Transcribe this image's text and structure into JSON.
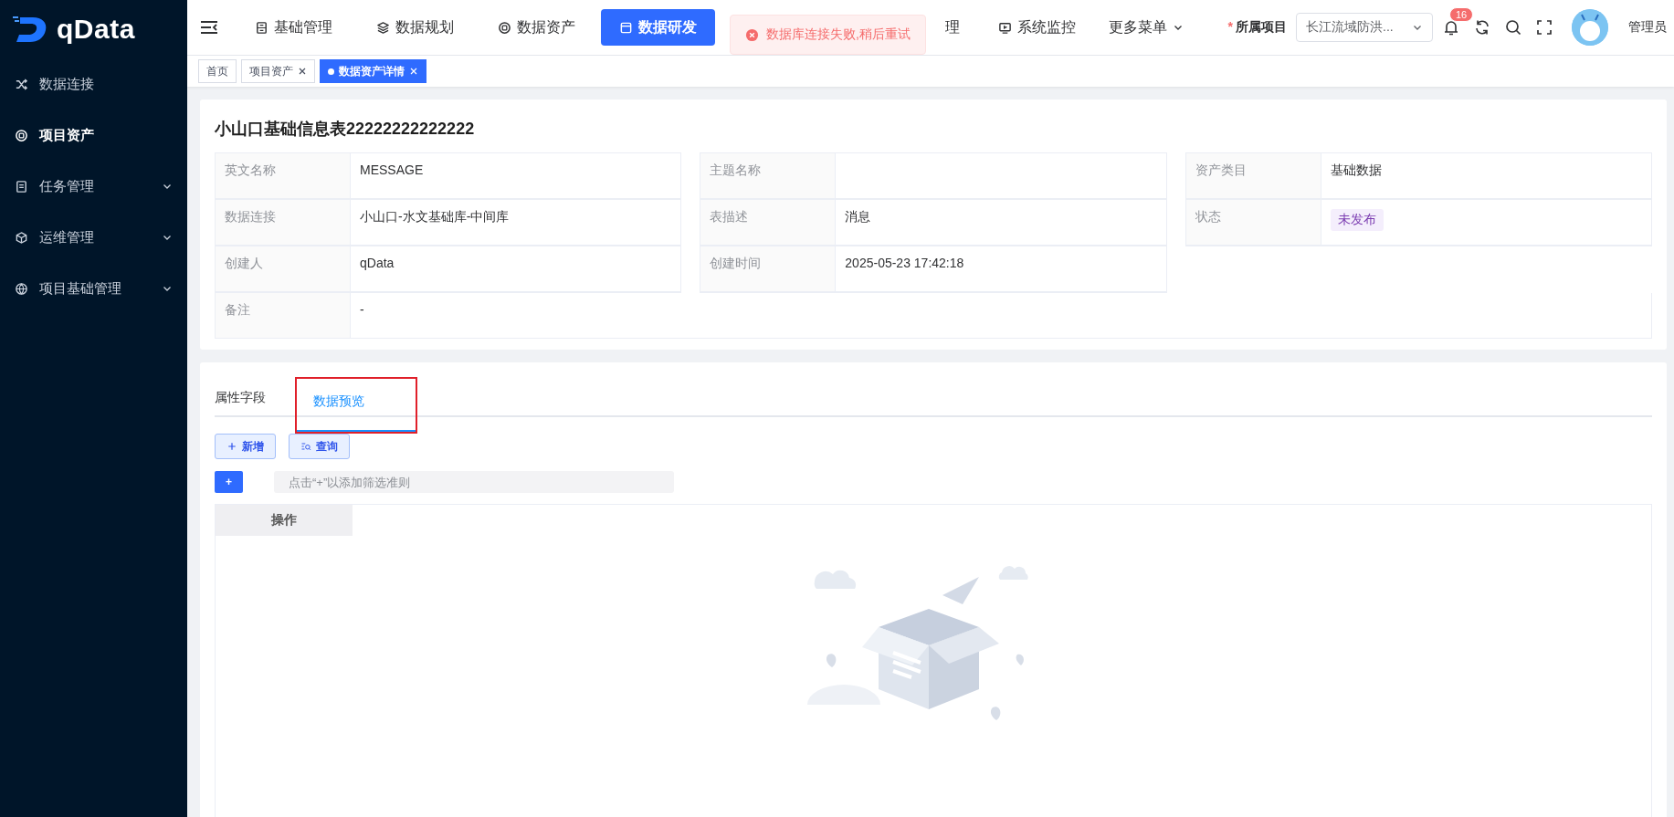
{
  "logo": {
    "text": "qData"
  },
  "sidebar": {
    "items": [
      {
        "label": "数据连接",
        "selected": false
      },
      {
        "label": "项目资产",
        "selected": true
      },
      {
        "label": "任务管理",
        "selected": false,
        "expanded": false
      },
      {
        "label": "运维管理",
        "selected": false,
        "expanded": false
      },
      {
        "label": "项目基础管理",
        "selected": false,
        "expanded": false
      }
    ]
  },
  "top_menu": [
    {
      "label": "基础管理",
      "kind": "link",
      "selected": false
    },
    {
      "label": "数据规划",
      "kind": "link",
      "selected": false
    },
    {
      "label": "数据资产",
      "kind": "link",
      "selected": false
    },
    {
      "label": "数据研发",
      "kind": "link",
      "selected": true
    },
    {
      "label": "理",
      "kind": "link",
      "selected": false
    },
    {
      "label": "系统监控",
      "kind": "link",
      "selected": false
    },
    {
      "label": "更多菜单",
      "kind": "dropdown",
      "selected": false
    }
  ],
  "toast": {
    "message": "数据库连接失败,稍后重试"
  },
  "project": {
    "required_mark": "*",
    "label": "所属项目",
    "value": "长江流域防洪..."
  },
  "notifications": {
    "count": "16"
  },
  "user": {
    "name": "管理员"
  },
  "breadcrumb_tabs": [
    {
      "label": "首页",
      "selected": false,
      "closable": false
    },
    {
      "label": "项目资产",
      "selected": false,
      "closable": true
    },
    {
      "label": "数据资产详情",
      "selected": true,
      "closable": true
    }
  ],
  "detail": {
    "title": "小山口基础信息表22222222222222",
    "columns": [
      [
        {
          "label": "英文名称",
          "value": "MESSAGE"
        },
        {
          "label": "数据连接",
          "value": "小山口-水文基础库-中间库"
        },
        {
          "label": "创建人",
          "value": "qData"
        }
      ],
      [
        {
          "label": "主题名称"
        },
        {
          "label": "表描述",
          "value": "消息"
        },
        {
          "label": "创建时间",
          "value": "2025-05-23 17:42:18"
        }
      ],
      [
        {
          "label": "资产类目",
          "value": "基础数据"
        },
        {
          "label": "状态",
          "value": "未发布",
          "kind": "tag"
        }
      ]
    ],
    "remark": {
      "label": "备注",
      "value": "-"
    }
  },
  "tabs": [
    {
      "label": "属性字段",
      "selected": false
    },
    {
      "label": "数据预览",
      "selected": true
    }
  ],
  "actions": [
    {
      "label": "新增"
    },
    {
      "label": "查询"
    }
  ],
  "filter": {
    "add": "+",
    "placeholder": "点击“+”以添加筛选准则"
  },
  "table": {
    "columns": [
      "操作"
    ]
  }
}
